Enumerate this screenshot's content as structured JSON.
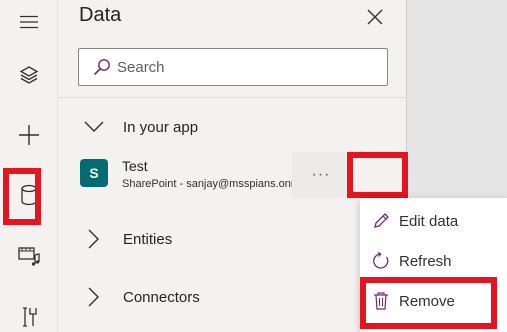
{
  "rail": {
    "items": [
      {
        "name": "hamburger-icon"
      },
      {
        "name": "layers-icon"
      },
      {
        "name": "plus-icon"
      },
      {
        "name": "database-icon",
        "highlighted": true
      },
      {
        "name": "media-icon"
      },
      {
        "name": "tools-icon"
      }
    ]
  },
  "panel": {
    "title": "Data",
    "search_placeholder": "Search",
    "in_your_app": "In your app",
    "source": {
      "name": "Test",
      "subtitle": "SharePoint - sanjay@msspians.onmicro...",
      "more_label": "···"
    },
    "entities": "Entities",
    "connectors": "Connectors"
  },
  "context_menu": {
    "edit": "Edit data",
    "refresh": "Refresh",
    "remove": "Remove"
  },
  "colors": {
    "highlight": "#e6141e",
    "sharepoint": "#036c70",
    "accent": "#742774"
  }
}
